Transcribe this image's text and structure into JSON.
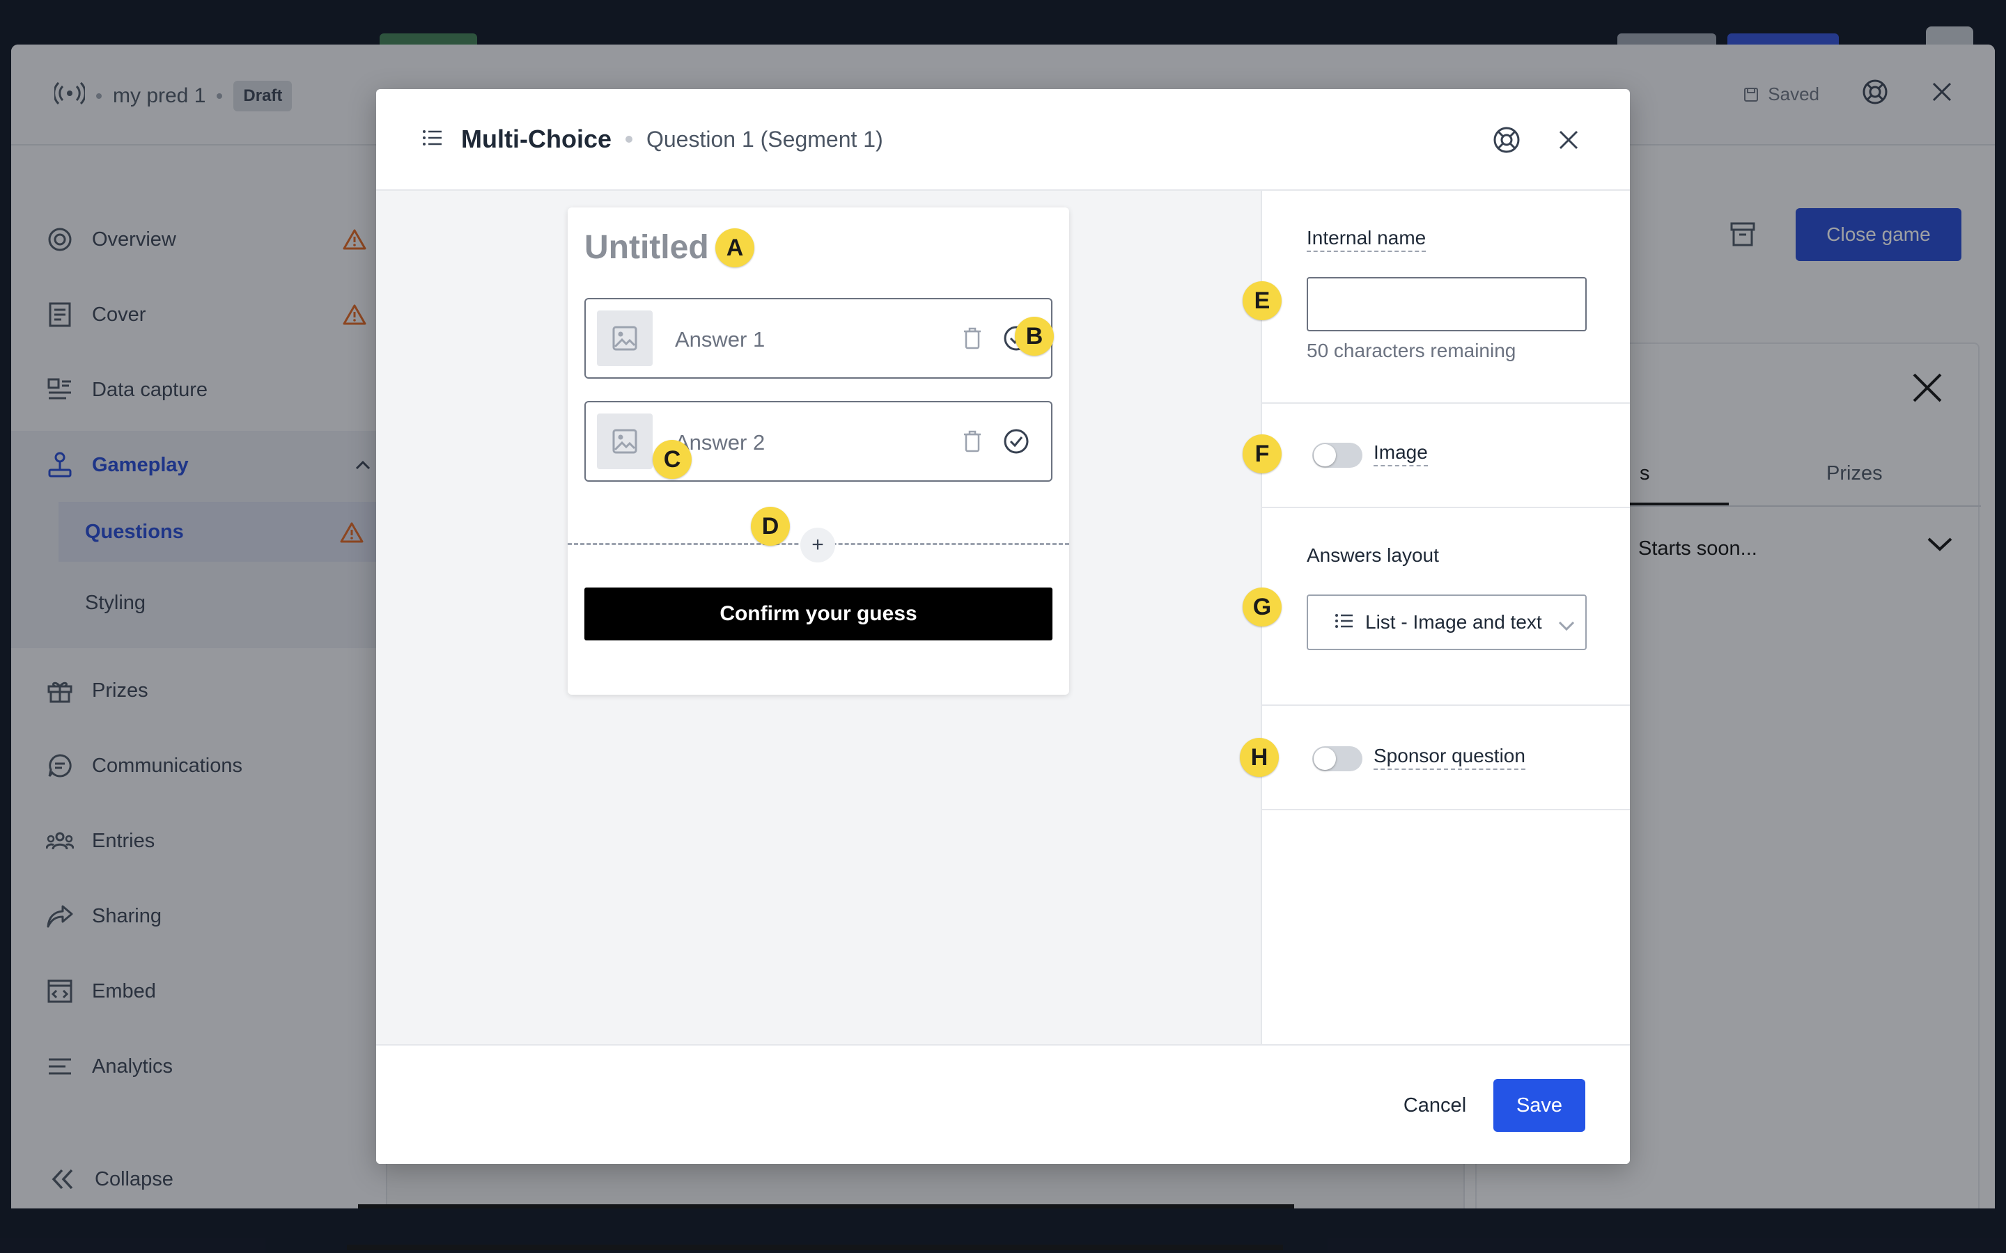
{
  "app": {
    "breadcrumb": {
      "name": "my pred 1",
      "status": "Draft"
    },
    "header": {
      "saved_label": "Saved"
    },
    "close_game_label": "Close game",
    "colors": {
      "accent": "#2447d0",
      "save": "#2454e6",
      "marker": "#f7d842",
      "warning": "#e0651f"
    }
  },
  "sidebar": {
    "items": [
      {
        "label": "Overview",
        "icon": "target-icon",
        "warning": true
      },
      {
        "label": "Cover",
        "icon": "document-icon",
        "warning": true
      },
      {
        "label": "Data capture",
        "icon": "form-icon",
        "warning": false
      },
      {
        "label": "Gameplay",
        "icon": "joystick-icon",
        "warning": false,
        "active": true,
        "expanded": true
      },
      {
        "label": "Prizes",
        "icon": "gift-icon",
        "warning": false
      },
      {
        "label": "Communications",
        "icon": "chat-icon",
        "warning": false
      },
      {
        "label": "Entries",
        "icon": "users-icon",
        "warning": false
      },
      {
        "label": "Sharing",
        "icon": "share-icon",
        "warning": false
      },
      {
        "label": "Embed",
        "icon": "embed-icon",
        "warning": false
      },
      {
        "label": "Analytics",
        "icon": "analytics-icon",
        "warning": false
      }
    ],
    "subitems": [
      {
        "label": "Questions",
        "active": true,
        "warning": true
      },
      {
        "label": "Styling",
        "active": false,
        "warning": false
      }
    ],
    "collapse_label": "Collapse"
  },
  "side_panel": {
    "tab_partial": "s",
    "tab_prizes": "Prizes",
    "status_partial": "Starts soon..."
  },
  "modal": {
    "title": "Multi-Choice",
    "subtitle": "Question 1 (Segment 1)",
    "preview": {
      "question_title": "Untitled",
      "answers": [
        {
          "label": "Answer 1"
        },
        {
          "label": "Answer 2"
        }
      ],
      "add_label": "+",
      "confirm_label": "Confirm your guess"
    },
    "markers": [
      "A",
      "B",
      "C",
      "D",
      "E",
      "F",
      "G",
      "H"
    ],
    "settings": {
      "internal_name": {
        "label": "Internal name",
        "value": "",
        "help": "50 characters remaining"
      },
      "image": {
        "label": "Image",
        "enabled": false
      },
      "answers_layout": {
        "label": "Answers layout",
        "selected": "List - Image and text"
      },
      "sponsor": {
        "label": "Sponsor question",
        "enabled": false
      }
    },
    "footer": {
      "cancel_label": "Cancel",
      "save_label": "Save"
    }
  }
}
